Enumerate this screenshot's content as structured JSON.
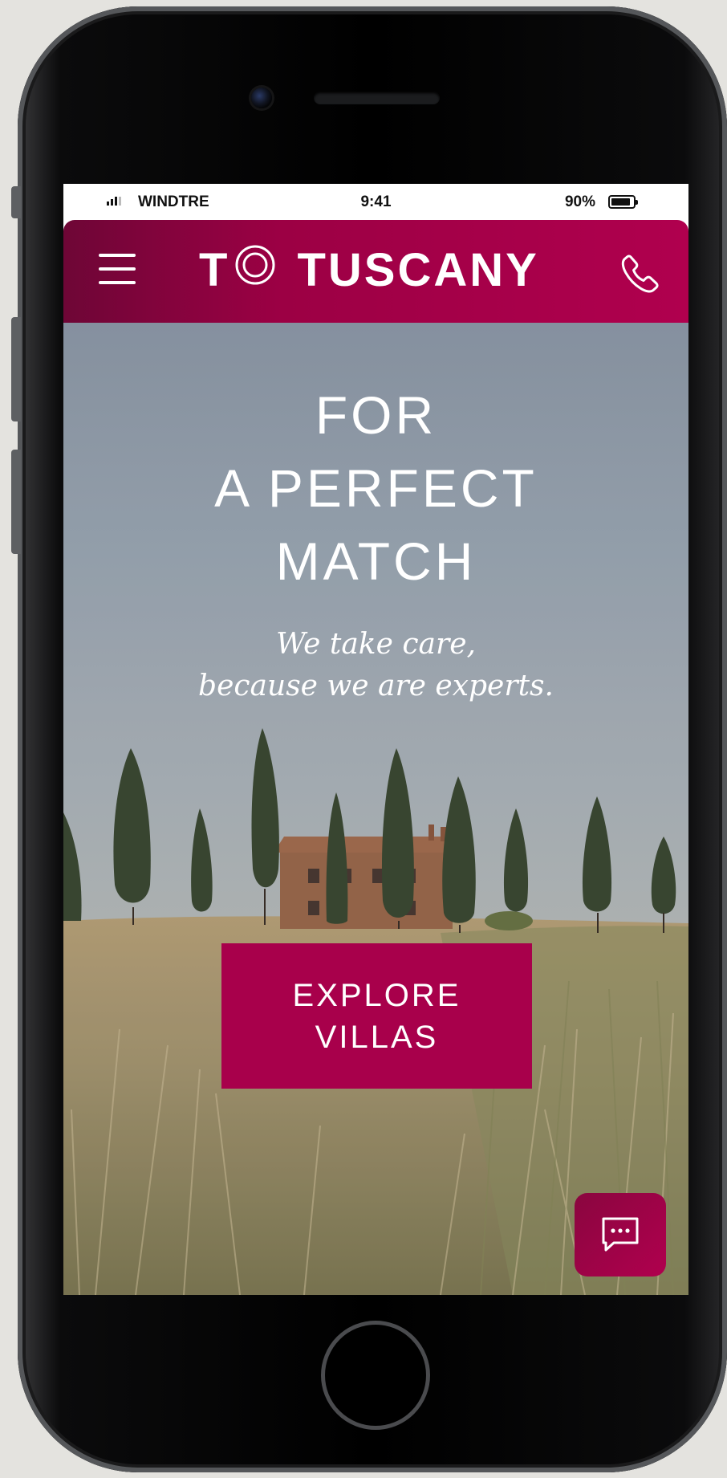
{
  "status_bar": {
    "carrier": "WINDTRE",
    "time": "9:41",
    "battery_percent": "90%",
    "battery_level": 0.9,
    "signal_bars": 3
  },
  "header": {
    "logo_text": "TUSCANY",
    "logo_prefix": "T",
    "menu_icon": "hamburger-menu-icon",
    "phone_icon": "phone-icon",
    "background_colors": [
      "#6e0636",
      "#b0004e"
    ]
  },
  "hero": {
    "title_lines": [
      "FOR",
      "A PERFECT",
      "MATCH"
    ],
    "subtitle_lines": [
      "We take care,",
      "because we are experts."
    ],
    "cta_lines": [
      "EXPLORE",
      "VILLAS"
    ],
    "cta_color": "#a8004b"
  },
  "chat": {
    "icon": "chat-bubble-icon",
    "color": "#a8004b"
  }
}
